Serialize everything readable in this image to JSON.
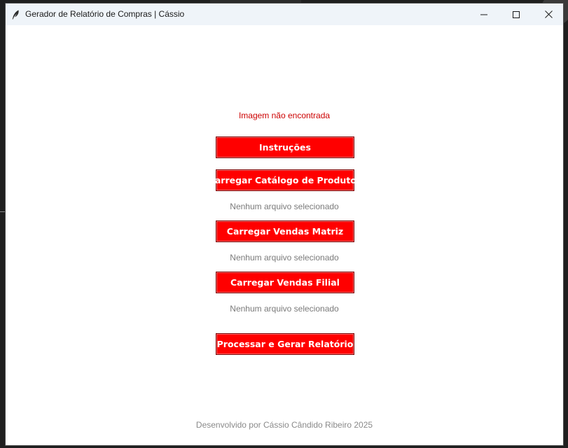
{
  "window": {
    "title": "Gerador de Relatório de Compras | Cássio"
  },
  "main": {
    "image_status": "Imagem não encontrada",
    "buttons": {
      "instructions": "Instruções",
      "load_catalog": "Carregar Catálogo de Produtos",
      "load_sales_matrix": "Carregar Vendas Matriz",
      "load_sales_branch": "Carregar Vendas Filial",
      "process_report": "Processar e Gerar Relatório"
    },
    "file_status": {
      "catalog": "Nenhum arquivo selecionado",
      "sales_matrix": "Nenhum arquivo selecionado",
      "sales_branch": "Nenhum arquivo selecionado"
    },
    "footer": "Desenvolvido por Cássio Cândido Ribeiro 2025"
  },
  "colors": {
    "button_bg": "#ff0000",
    "button_text": "#ffffff",
    "warning_text": "#cc0000",
    "muted_text": "#7a7a7a"
  },
  "icons": {
    "app": "feather-icon",
    "minimize": "minimize-icon",
    "maximize": "maximize-icon",
    "close": "close-icon"
  }
}
